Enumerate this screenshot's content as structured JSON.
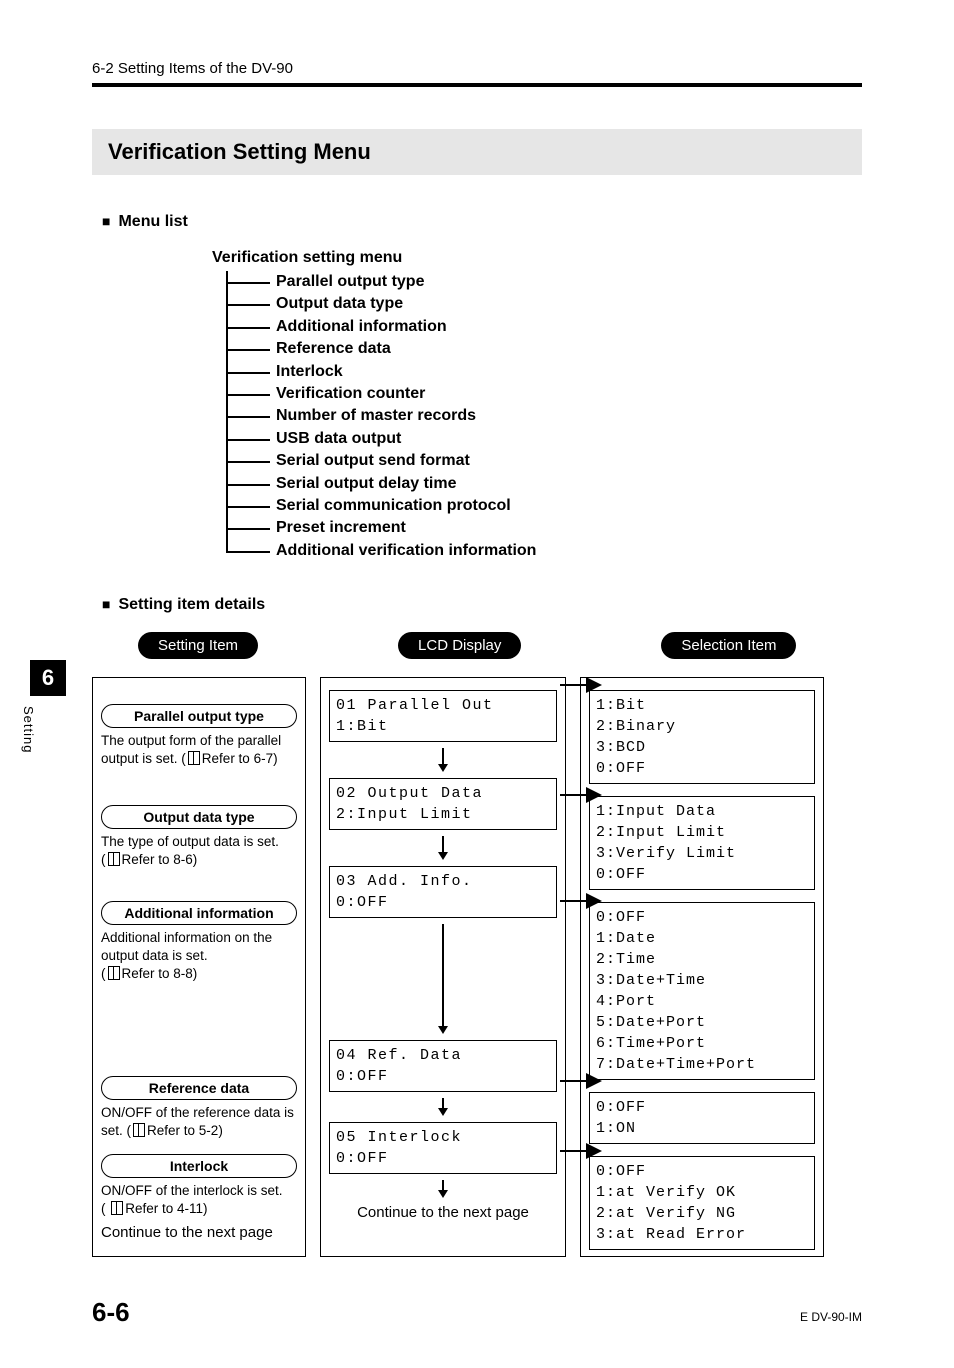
{
  "header": {
    "breadcrumb": "6-2  Setting Items of the DV-90"
  },
  "section_title": "Verification Setting Menu",
  "subheads": {
    "menu_list": "Menu list",
    "details": "Setting item details"
  },
  "menu_tree": {
    "root": "Verification setting menu",
    "items": [
      "Parallel output type",
      "Output data type",
      "Additional information",
      "Reference data",
      "Interlock",
      "Verification counter",
      "Number of master records",
      "USB data output",
      "Serial output send format",
      "Serial output delay time",
      "Serial communication protocol",
      "Preset increment",
      "Additional verification information"
    ]
  },
  "pills": {
    "setting_item": "Setting Item",
    "lcd_display": "LCD Display",
    "selection_item": "Selection Item"
  },
  "left_items": [
    {
      "title": "Parallel output type",
      "desc_pre": "The output form of the parallel output is set. (",
      "ref": "Refer to 6-7",
      "desc_post": ")"
    },
    {
      "title": "Output data type",
      "desc_pre": "The type of output data is set.\n(",
      "ref": "Refer to 8-6",
      "desc_post": ")"
    },
    {
      "title": "Additional information",
      "desc_pre": "Additional information on the output data is set.\n(",
      "ref": "Refer to 8-8",
      "desc_post": ")"
    },
    {
      "title": "Reference data",
      "desc_pre": "ON/OFF of the reference data is set. (",
      "ref": "Refer to 5-2",
      "desc_post": ")"
    },
    {
      "title": "Interlock",
      "desc_pre": "ON/OFF of the interlock is set.\n( ",
      "ref": "Refer to 4-11",
      "desc_post": ")"
    }
  ],
  "left_continue": "Continue to the next page",
  "lcd": [
    "01 Parallel Out\n1:Bit",
    "02 Output Data\n2:Input Limit",
    "03 Add. Info.\n0:OFF",
    "04 Ref. Data\n0:OFF",
    "05 Interlock\n0:OFF"
  ],
  "mid_continue": "Continue to the next page",
  "selection": [
    "1:Bit\n2:Binary\n3:BCD\n0:OFF",
    "1:Input Data\n2:Input Limit\n3:Verify Limit\n0:OFF",
    "0:OFF\n1:Date\n2:Time\n3:Date+Time\n4:Port\n5:Date+Port\n6:Time+Port\n7:Date+Time+Port",
    "0:OFF\n1:ON",
    "0:OFF\n1:at Verify OK\n2:at Verify NG\n3:at Read Error"
  ],
  "side": {
    "chapter": "6",
    "label": "Setting"
  },
  "footer": {
    "page": "6-6",
    "doc": "E DV-90-IM"
  }
}
